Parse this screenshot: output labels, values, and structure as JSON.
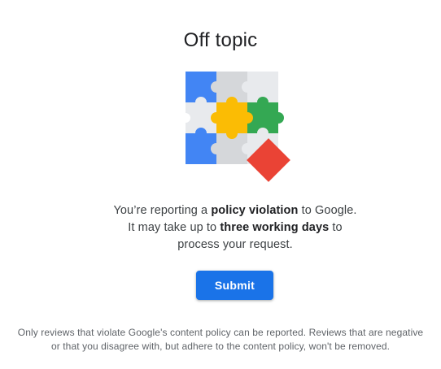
{
  "dialog": {
    "title": "Off topic",
    "illustration": "puzzle-pieces-illustration",
    "message": {
      "part1": "You’re reporting a ",
      "bold1": "policy violation",
      "part2": " to Google. It may take up to ",
      "bold2": "three working days",
      "part3": " to process your request."
    },
    "submit_label": "Submit",
    "footnote": "Only reviews that violate Google's content policy can be reported. Reviews that are negative or that you disagree with, but adhere to the content policy, won't be removed."
  },
  "colors": {
    "accent": "#1a73e8",
    "puzzle_blue": "#4285f4",
    "puzzle_yellow": "#fbbc04",
    "puzzle_green": "#34a853",
    "puzzle_red": "#ea4335",
    "puzzle_gray": "#dadce0"
  }
}
